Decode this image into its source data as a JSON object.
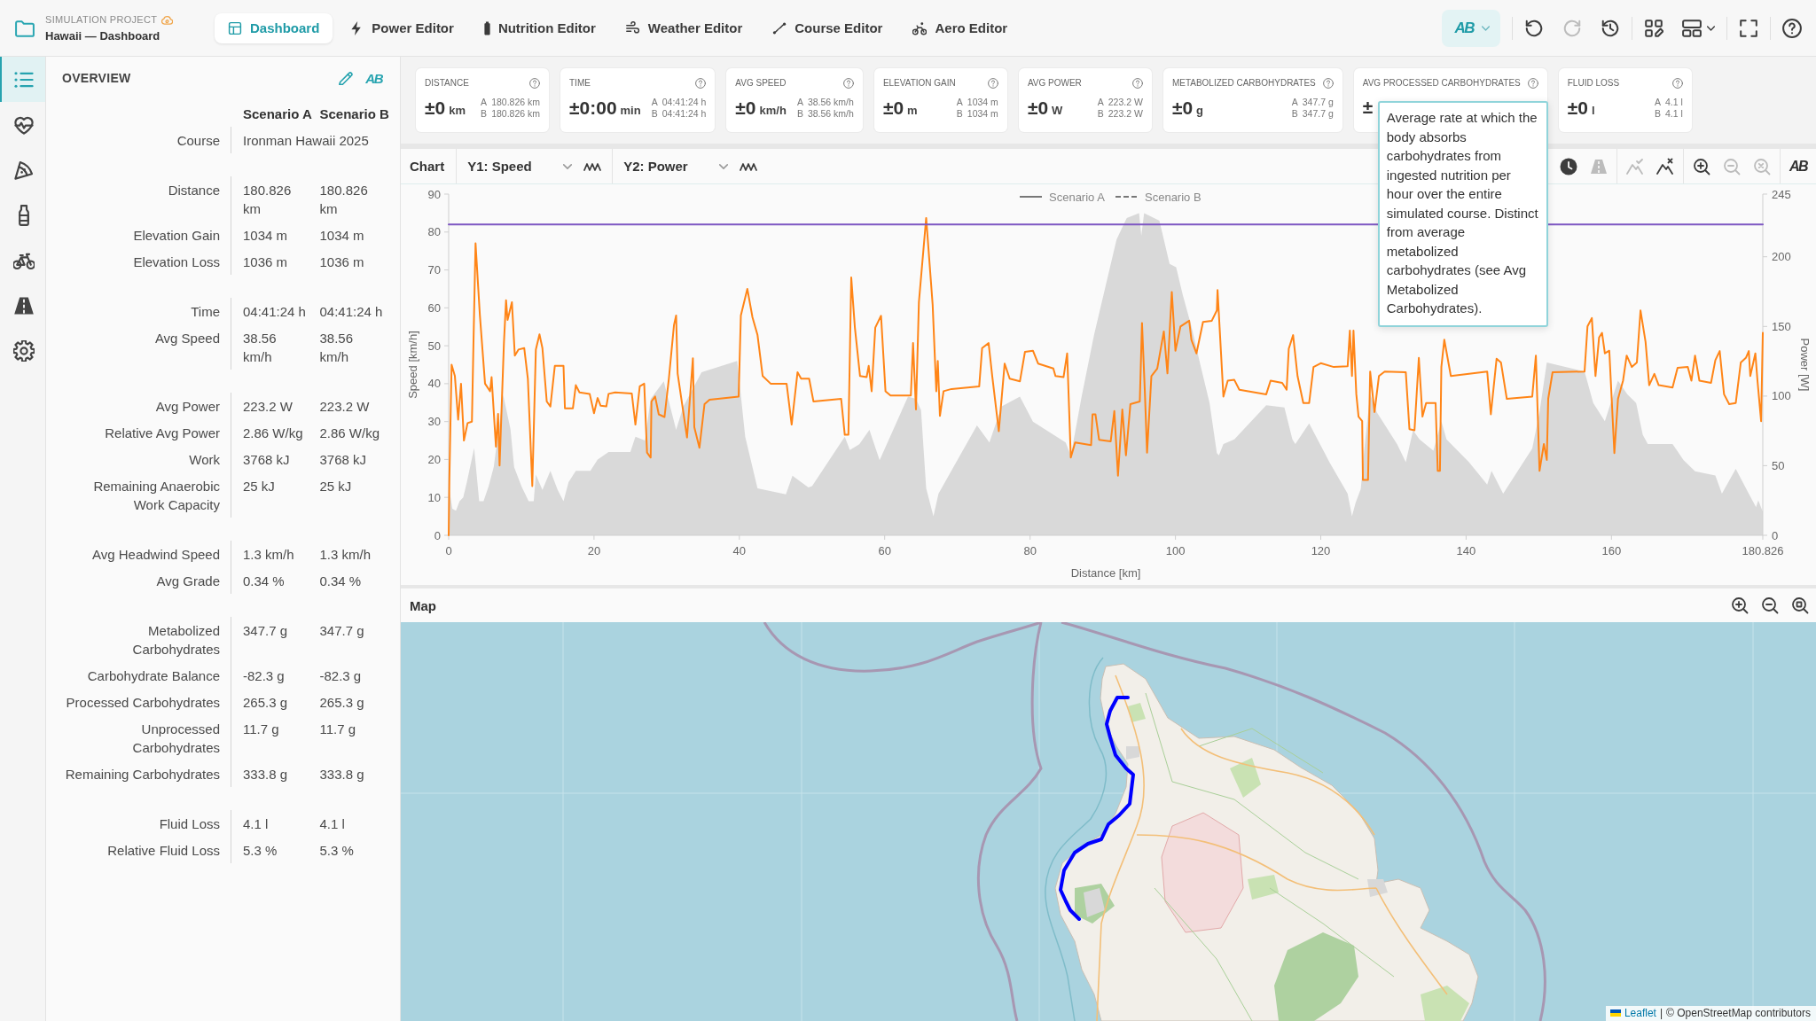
{
  "header": {
    "project_label": "SIMULATION PROJECT",
    "project_name": "Hawaii — Dashboard",
    "tabs": [
      {
        "label": "Dashboard",
        "selected": true
      },
      {
        "label": "Power Editor",
        "selected": false
      },
      {
        "label": "Nutrition Editor",
        "selected": false
      },
      {
        "label": "Weather Editor",
        "selected": false
      },
      {
        "label": "Course Editor",
        "selected": false
      },
      {
        "label": "Aero Editor",
        "selected": false
      }
    ],
    "toolbar": [
      [
        {
          "kind": "compare",
          "label": "AB",
          "disabled": false
        }
      ],
      [
        {
          "kind": "undo",
          "disabled": false
        },
        {
          "kind": "redo",
          "disabled": true
        },
        {
          "kind": "history",
          "disabled": false
        }
      ],
      [
        {
          "kind": "grid-edit",
          "disabled": false
        },
        {
          "kind": "layout-menu",
          "disabled": false
        }
      ],
      [
        {
          "kind": "fullscreen",
          "disabled": false
        }
      ],
      [
        {
          "kind": "help",
          "disabled": false
        }
      ]
    ]
  },
  "rail": [
    {
      "kind": "list",
      "selected": true
    },
    {
      "kind": "heart",
      "selected": false
    },
    {
      "kind": "pizza",
      "selected": false
    },
    {
      "kind": "bottle",
      "selected": false
    },
    {
      "kind": "bike",
      "selected": false
    },
    {
      "kind": "road",
      "selected": false
    },
    {
      "kind": "gear",
      "selected": false
    }
  ],
  "overview": {
    "title": "OVERVIEW",
    "tools": [
      {
        "kind": "edit"
      },
      {
        "kind": "compare",
        "label": "AB"
      }
    ],
    "columns": [
      "Scenario A",
      "Scenario B"
    ],
    "groups": [
      {
        "rows": [
          {
            "label": "Course",
            "values": [
              "Ironman Hawaii 2025"
            ]
          }
        ]
      },
      {
        "rows": [
          {
            "label": "Distance",
            "values": [
              "180.826 km",
              "180.826 km"
            ]
          },
          {
            "label": "Elevation Gain",
            "values": [
              "1034 m",
              "1034 m"
            ]
          },
          {
            "label": "Elevation Loss",
            "values": [
              "1036 m",
              "1036 m"
            ]
          }
        ]
      },
      {
        "rows": [
          {
            "label": "Time",
            "values": [
              "04:41:24 h",
              "04:41:24 h"
            ]
          },
          {
            "label": "Avg Speed",
            "values": [
              "38.56 km/h",
              "38.56 km/h"
            ]
          }
        ]
      },
      {
        "rows": [
          {
            "label": "Avg Power",
            "values": [
              "223.2 W",
              "223.2 W"
            ]
          },
          {
            "label": "Relative Avg Power",
            "values": [
              "2.86 W/kg",
              "2.86 W/kg"
            ]
          },
          {
            "label": "Work",
            "values": [
              "3768 kJ",
              "3768 kJ"
            ]
          },
          {
            "label": "Remaining Anaerobic Work Capacity",
            "values": [
              "25 kJ",
              "25 kJ"
            ]
          }
        ]
      },
      {
        "rows": [
          {
            "label": "Avg Headwind Speed",
            "values": [
              "1.3 km/h",
              "1.3 km/h"
            ]
          },
          {
            "label": "Avg Grade",
            "values": [
              "0.34 %",
              "0.34 %"
            ]
          }
        ]
      },
      {
        "rows": [
          {
            "label": "Metabolized Carbohydrates",
            "values": [
              "347.7 g",
              "347.7 g"
            ]
          },
          {
            "label": "Carbohydrate Balance",
            "values": [
              "-82.3 g",
              "-82.3 g"
            ]
          },
          {
            "label": "Processed Carbohydrates",
            "values": [
              "265.3 g",
              "265.3 g"
            ]
          },
          {
            "label": "Unprocessed Carbohydrates",
            "values": [
              "11.7 g",
              "11.7 g"
            ]
          },
          {
            "label": "Remaining Carbohydrates",
            "values": [
              "333.8 g",
              "333.8 g"
            ]
          }
        ]
      },
      {
        "rows": [
          {
            "label": "Fluid Loss",
            "values": [
              "4.1 l",
              "4.1 l"
            ]
          },
          {
            "label": "Relative Fluid Loss",
            "values": [
              "5.3 %",
              "5.3 %"
            ]
          }
        ]
      }
    ]
  },
  "metrics": [
    {
      "label": "DISTANCE",
      "value": "±0",
      "unit": "km",
      "comparison": [
        {
          "tag": "A",
          "value": "180.826 km"
        },
        {
          "tag": "B",
          "value": "180.826 km"
        }
      ]
    },
    {
      "label": "TIME",
      "value": "±0:00",
      "unit": "min",
      "comparison": [
        {
          "tag": "A",
          "value": "04:41:24 h"
        },
        {
          "tag": "B",
          "value": "04:41:24 h"
        }
      ]
    },
    {
      "label": "AVG SPEED",
      "value": "±0",
      "unit": "km/h",
      "comparison": [
        {
          "tag": "A",
          "value": "38.56 km/h"
        },
        {
          "tag": "B",
          "value": "38.56 km/h"
        }
      ]
    },
    {
      "label": "ELEVATION GAIN",
      "value": "±0",
      "unit": "m",
      "comparison": [
        {
          "tag": "A",
          "value": "1034 m"
        },
        {
          "tag": "B",
          "value": "1034 m"
        }
      ]
    },
    {
      "label": "AVG POWER",
      "value": "±0",
      "unit": "W",
      "comparison": [
        {
          "tag": "A",
          "value": "223.2 W"
        },
        {
          "tag": "B",
          "value": "223.2 W"
        }
      ]
    },
    {
      "label": "METABOLIZED CARBOHYDRATES",
      "value": "±0",
      "unit": "g",
      "comparison": [
        {
          "tag": "A",
          "value": "347.7 g"
        },
        {
          "tag": "B",
          "value": "347.7 g"
        }
      ]
    },
    {
      "label": "AVG PROCESSED CARBOHYDRATES",
      "value": "±",
      "tooltip": "Average rate at which the body absorbs carbohydrates from ingested nutrition per hour over the entire simulated course. Distinct from average metabolized carbohydrates (see Avg Metabolized Carbohydrates)."
    },
    {
      "label": "FLUID LOSS",
      "value": "±0",
      "unit": "l",
      "comparison": [
        {
          "tag": "A",
          "value": "4.1 l"
        },
        {
          "tag": "B",
          "value": "4.1 l"
        }
      ]
    }
  ],
  "chart_panel": {
    "title": "Chart",
    "tools": [
      [
        {
          "kind": "clock",
          "disabled": false
        },
        {
          "kind": "road",
          "disabled": true
        }
      ],
      [
        {
          "kind": "mountain-check",
          "disabled": true
        },
        {
          "kind": "mountain-x",
          "disabled": false
        }
      ],
      [
        {
          "kind": "zoom-in",
          "disabled": false
        },
        {
          "kind": "zoom-out",
          "disabled": true
        },
        {
          "kind": "zoom-reset",
          "disabled": true
        }
      ],
      [
        {
          "kind": "compare",
          "label": "AB",
          "disabled": false
        }
      ]
    ],
    "legend": [
      {
        "label": "Scenario A",
        "kind": "solid"
      },
      {
        "label": "Scenario B",
        "kind": "dashed"
      }
    ],
    "chart_data": {
      "type": "line",
      "xlabel": "Distance [km]",
      "ylabel": "Speed [km/h]",
      "y2label": "Power [W]",
      "x": [
        0,
        0.1,
        0.4,
        0.85,
        1.3,
        1.7,
        2.1,
        2.6,
        3.2,
        3.4,
        3.7,
        4.3,
        5,
        5.7,
        5.9,
        6.5,
        6.8,
        7,
        7.6,
        7.9,
        8.1,
        8.7,
        9.1,
        9.6,
        10.4,
        10.9,
        11.5,
        12,
        12.5,
        12.9,
        13.5,
        14,
        14.6,
        15.8,
        16,
        17.1,
        17.5,
        18,
        19.4,
        20,
        20.5,
        20.9,
        21.7,
        22,
        22.9,
        25.2,
        25.7,
        26.3,
        26.9,
        27.3,
        27.8,
        27.9,
        28.4,
        28.9,
        29.7,
        30.3,
        31,
        31.3,
        31.5,
        32.8,
        33.6,
        33.8,
        34.5,
        35.2,
        35.9,
        39.9,
        40.2,
        41.1,
        41.8,
        42.5,
        43.2,
        44.3,
        46.5,
        47.2,
        48,
        48.5,
        49.6,
        50.2,
        54,
        54.5,
        55,
        55.4,
        55.9,
        56.6,
        57.5,
        57.8,
        58.2,
        58.7,
        59.5,
        60.1,
        60.8,
        63.6,
        63.9,
        64.3,
        64.7,
        65.7,
        66.6,
        67.1,
        67.3,
        67.6,
        68.1,
        69.2,
        73,
        73.4,
        74.3,
        74.8,
        75.7,
        76.5,
        77.2,
        78.6,
        79.3,
        80.4,
        81.1,
        83.2,
        83.5,
        84.6,
        85.1,
        85.6,
        86.2,
        88.4,
        88.6,
        89,
        89.5,
        91.1,
        91.6,
        92.1,
        92.7,
        93.2,
        93.8,
        95.1,
        95.4,
        95.8,
        96.1,
        96.7,
        97.5,
        98.4,
        98.9,
        99.5,
        100,
        100.7,
        101.9,
        102.2,
        102.9,
        103.8,
        105,
        105.7,
        105.8,
        106.6,
        107.2,
        108.1,
        108.8,
        112.5,
        113.1,
        114.7,
        115.3,
        115.6,
        116.2,
        116.8,
        117.6,
        118.4,
        119,
        120,
        121.8,
        123.7,
        124,
        124.3,
        124.5,
        124.9,
        125.2,
        125.7,
        125.8,
        126.5,
        126.8,
        127.4,
        128,
        128.8,
        131.7,
        132.2,
        132.9,
        133.5,
        134,
        134.5,
        135.8,
        136.1,
        136.4,
        136.6,
        137,
        137.9,
        142.9,
        143.4,
        144.2,
        144.8,
        145.6,
        149.1,
        149.6,
        150.1,
        150.7,
        151.1,
        151.3,
        151.9,
        156.3,
        156.7,
        157.3,
        157.8,
        158.3,
        158.7,
        159.1,
        159.7,
        160.4,
        160.9,
        161.6,
        162.1,
        162.8,
        163.5,
        164,
        164.7,
        165.2,
        165.9,
        166.5,
        168.4,
        169.1,
        170.5,
        171,
        171.5,
        172.1,
        173.7,
        174.3,
        174.9,
        175.5,
        176.2,
        177.1,
        177.8,
        178.5,
        178.9,
        179.1,
        179.8,
        180.1,
        180.6,
        180.826
      ],
      "series": [
        {
          "type": "area",
          "color": "#d9d9d9",
          "x": [
            0,
            0.1,
            0.5,
            1,
            1.5,
            2,
            2.5,
            3.5,
            4.2,
            4.8,
            5.5,
            6.2,
            7.5,
            8.5,
            9,
            10,
            11,
            11.7,
            12,
            12.9,
            14,
            15,
            15.8,
            16.5,
            17.5,
            19.5,
            20.5,
            22,
            25,
            25.7,
            27,
            27.8,
            29.6,
            31.3,
            32.3,
            34.8,
            39.7,
            40.8,
            42.5,
            46.4,
            47.3,
            49.5,
            50,
            54.5,
            55.2,
            56.5,
            57.9,
            59.3,
            63.2,
            64.3,
            65,
            65.7,
            66.7,
            67.4,
            72.7,
            74.4,
            76.1,
            78.6,
            80.4,
            84.9,
            85.6,
            87.1,
            88.8,
            91.9,
            93.3,
            95,
            95.3,
            95.7,
            97.8,
            99.2,
            100.1,
            101,
            102.2,
            103.5,
            104.7,
            105.7,
            106,
            106.6,
            108.1,
            112.5,
            115,
            116.1,
            116.5,
            118.4,
            121.2,
            123.7,
            124.3,
            124.8,
            125.5,
            126,
            126.8,
            127.7,
            130.5,
            131.7,
            132.7,
            133.6,
            135.5,
            136.6,
            137.3,
            140.4,
            142.9,
            143.5,
            145.1,
            149.1,
            150.1,
            151.1,
            156.3,
            157.5,
            159.1,
            159.7,
            160.9,
            162.2,
            163.4,
            164.3,
            165,
            168.4,
            169.9,
            171.5,
            174.3,
            175.2,
            177.1,
            178.9,
            179.9,
            180.2,
            180.826
          ],
          "values": [
            0,
            12,
            7,
            6.5,
            9,
            10,
            14,
            23,
            9,
            9,
            13,
            18,
            37,
            28,
            18,
            13,
            9,
            9,
            16,
            12,
            17,
            12,
            9,
            14,
            17,
            17,
            20,
            22,
            22,
            26,
            25,
            36,
            40.6,
            27.8,
            34,
            43,
            46,
            26,
            12.4,
            10.8,
            15.7,
            12.6,
            13,
            26,
            22.5,
            24,
            27.8,
            19.8,
            36.6,
            36,
            33,
            12.4,
            5,
            11,
            29,
            24.5,
            34,
            36.6,
            30,
            24.5,
            21,
            36.6,
            52.8,
            78,
            83.7,
            85,
            79,
            85,
            83,
            71.6,
            70.7,
            63.5,
            55.1,
            44.4,
            34.9,
            21.7,
            21.1,
            24.1,
            25.3,
            34.3,
            33.7,
            25.3,
            24.1,
            29.5,
            19.3,
            11,
            5,
            8.6,
            12.2,
            22.9,
            37.2,
            32.5,
            24.1,
            19.3,
            27.7,
            25.3,
            22.3,
            30.1,
            25.3,
            19.3,
            13.4,
            17,
            11,
            22.9,
            32.5,
            45.6,
            43.2,
            34.9,
            30.1,
            33.7,
            40.8,
            37.2,
            34.9,
            26.5,
            24.1,
            24.1,
            19.9,
            16.9,
            15.8,
            11,
            17.5,
            11,
            7.4,
            9.2,
            6.2
          ]
        },
        {
          "name": "Y1: Speed",
          "color": "#ff8517",
          "values": [
            0,
            15,
            45,
            42,
            30.5,
            40,
            25,
            29.6,
            30,
            50,
            77,
            58,
            40,
            38,
            41.7,
            23.4,
            32,
            18.4,
            50.7,
            62,
            56.8,
            61.5,
            47.4,
            49,
            49.4,
            41.3,
            13,
            49,
            53,
            49.4,
            35.3,
            34,
            44.7,
            44.7,
            33.5,
            33.5,
            39.6,
            37.7,
            37.3,
            32.2,
            36.2,
            34.2,
            34,
            37.3,
            37.7,
            37.4,
            29.2,
            39.3,
            40,
            21.8,
            20.5,
            35.3,
            36.6,
            31.9,
            31.2,
            41.3,
            55.5,
            58,
            42.7,
            25.8,
            46.7,
            28.5,
            23.1,
            34.6,
            35.8,
            36.6,
            58,
            65,
            57.5,
            52.8,
            42,
            40,
            40,
            29.2,
            43,
            41.3,
            41.3,
            35.3,
            36,
            26.5,
            26.5,
            68,
            54.8,
            42,
            41.7,
            44.7,
            38,
            54.8,
            57.9,
            38,
            36.9,
            36.9,
            50.7,
            33.2,
            61.5,
            83.7,
            60.8,
            38,
            46,
            31.5,
            38,
            38.6,
            39.3,
            49.4,
            50.7,
            42,
            27.5,
            45.3,
            41.3,
            40.6,
            48.4,
            48.7,
            45.3,
            44,
            42,
            41.7,
            48,
            20.5,
            24.5,
            23.8,
            31.9,
            31.9,
            25.2,
            24.8,
            32.8,
            15.7,
            33.2,
            21.1,
            34.6,
            35.3,
            56,
            37.3,
            21.8,
            42,
            44,
            53.8,
            42.7,
            64.2,
            48.7,
            55.1,
            56.6,
            51.6,
            48,
            56.3,
            56.6,
            59.3,
            64.7,
            36.6,
            40.8,
            41,
            38.4,
            37.2,
            40.8,
            40.2,
            38.4,
            49.2,
            52.8,
            42,
            34.9,
            34.9,
            44.4,
            45.4,
            44.4,
            44.6,
            54,
            42,
            54,
            37.2,
            31.3,
            30.1,
            14.6,
            14.6,
            43.2,
            32.5,
            42,
            43.2,
            43,
            28,
            27.7,
            46.8,
            31.3,
            34.9,
            34.9,
            17,
            17,
            44.4,
            51.6,
            42,
            43.2,
            31.9,
            46.6,
            45.6,
            36,
            36.6,
            47.4,
            17,
            24.1,
            19.9,
            36,
            43,
            43.2,
            55.1,
            57.3,
            42,
            52.2,
            53.4,
            48,
            48.7,
            21.7,
            36,
            40.8,
            47.4,
            44.4,
            45.6,
            59.3,
            51,
            39.6,
            42.6,
            39.6,
            39,
            44.2,
            44.4,
            40.8,
            47.4,
            40.8,
            40.2,
            46.2,
            48.6,
            37.2,
            34.6,
            34.9,
            45.6,
            46.8,
            48.6,
            42,
            48,
            40.8,
            30.1,
            53.4
          ]
        },
        {
          "name": "Y2: Power",
          "color": "#7e57c2",
          "axis": "y2",
          "x": [
            0,
            180.826
          ],
          "values": [
            223.2,
            223.2
          ]
        }
      ],
      "xlim": [
        0,
        180.826
      ],
      "ylim": [
        0,
        90
      ],
      "y2lim": [
        0,
        245
      ],
      "xticks": [
        0,
        20,
        40,
        60,
        80,
        100,
        120,
        140,
        160,
        180.826
      ],
      "yticks": [
        0,
        10,
        20,
        30,
        40,
        50,
        60,
        70,
        80,
        90
      ],
      "y2ticks": [
        0,
        50,
        100,
        150,
        200,
        245
      ]
    }
  },
  "map_panel": {
    "title": "Map",
    "tools": [
      {
        "kind": "zoom-in"
      },
      {
        "kind": "zoom-out"
      },
      {
        "kind": "zoom-fit"
      }
    ],
    "attribution": {
      "link": "Leaflet",
      "separator": "|",
      "text": "© OpenStreetMap contributors"
    }
  }
}
